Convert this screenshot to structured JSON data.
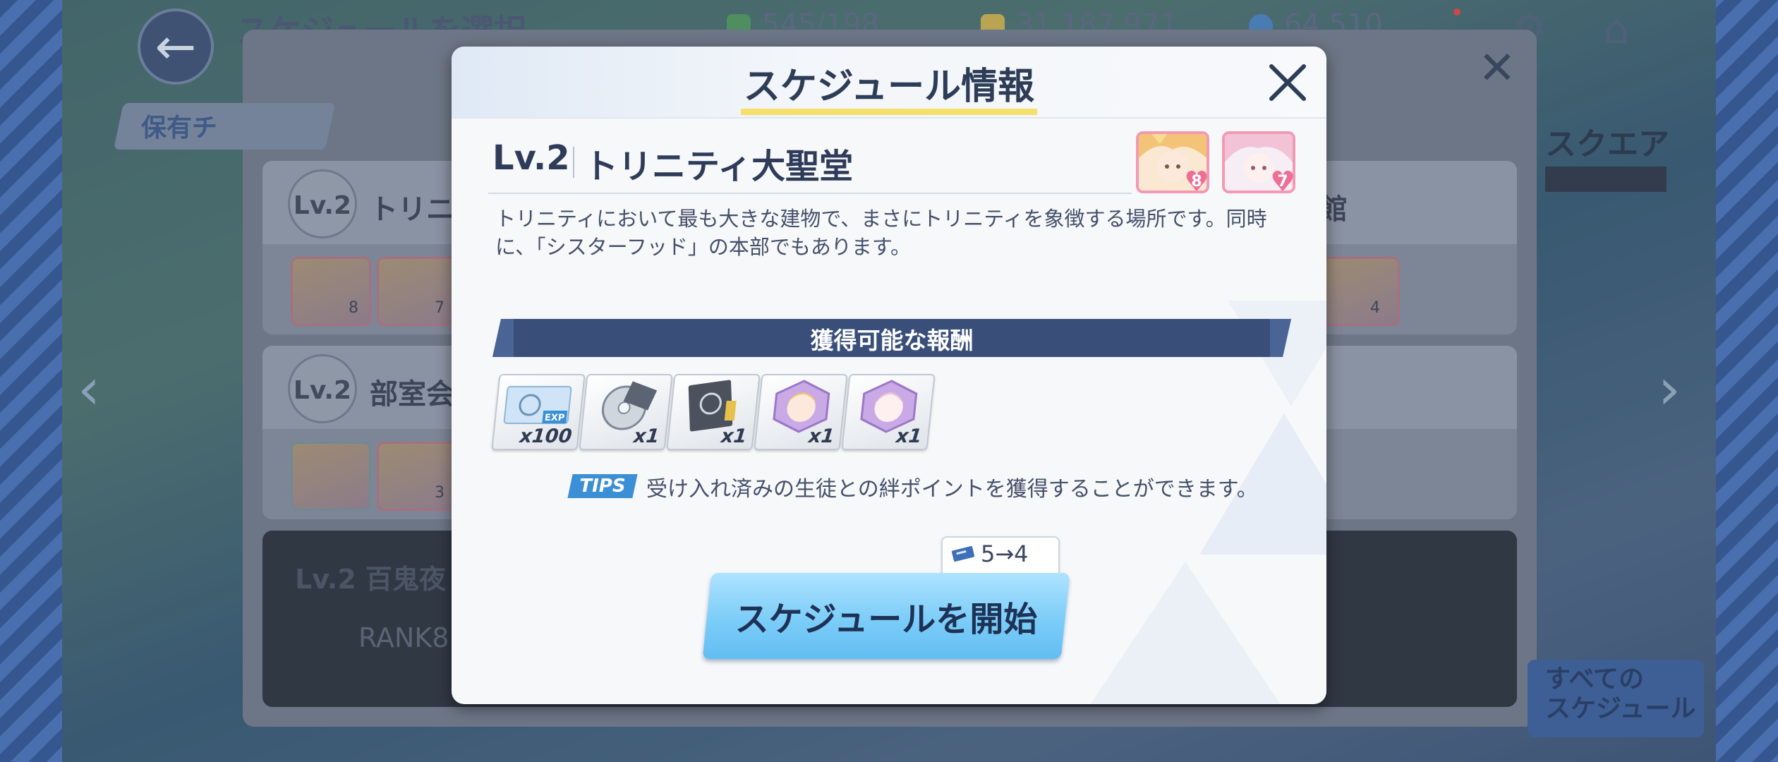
{
  "topbar": {
    "title": "スケジュールを選択",
    "ap": "545/198",
    "credits": "31,187,971",
    "gems": "64,510",
    "settings_icon": "gear-icon",
    "home_icon": "home-icon"
  },
  "background_panel": {
    "owned_label": "保有チ",
    "cards": [
      {
        "lv": "Lv.2",
        "name": "トリニテ",
        "portraits": [
          {
            "level": "8"
          },
          {
            "level": "7"
          }
        ]
      },
      {
        "lv": "Lv.2",
        "name": "部室会館",
        "portraits": [
          {
            "level": ""
          },
          {
            "level": "3"
          }
        ]
      },
      {
        "lv": "Lv.2",
        "name": "百鬼夜",
        "rank_lock": "RANK8"
      }
    ],
    "right_card_label": "スクエア",
    "right_card_suffix": "館",
    "right_card_level": "4",
    "all_schedules": "すべての\nスケジュール"
  },
  "modal": {
    "title": "スケジュール情報",
    "close_icon": "close-icon",
    "level": "Lv.2",
    "location_name": "トリニティ大聖堂",
    "students": [
      {
        "name": "student-blonde",
        "level": "8",
        "color": "#f3c478"
      },
      {
        "name": "student-pink",
        "level": "7",
        "color": "#f4c7d8"
      }
    ],
    "description": "トリニティにおいて最も大きな建物で、まさにトリニティを象徴する場所です。同時に、「シスターフッド」の本部でもあります。",
    "rewards_title": "獲得可能な報酬",
    "rewards": [
      {
        "item": "exp-ticket",
        "badge": "EXP",
        "qty": "x100"
      },
      {
        "item": "disc-item",
        "qty": "x1"
      },
      {
        "item": "notebook-item",
        "qty": "x1"
      },
      {
        "item": "student-token-blonde",
        "qty": "x1"
      },
      {
        "item": "student-token-pink",
        "qty": "x1"
      }
    ],
    "tips_label": "TIPS",
    "tips_text": "受け入れ済みの生徒との絆ポイントを獲得することができます。",
    "ticket_cost": "5→4",
    "start_button": "スケジュールを開始"
  }
}
